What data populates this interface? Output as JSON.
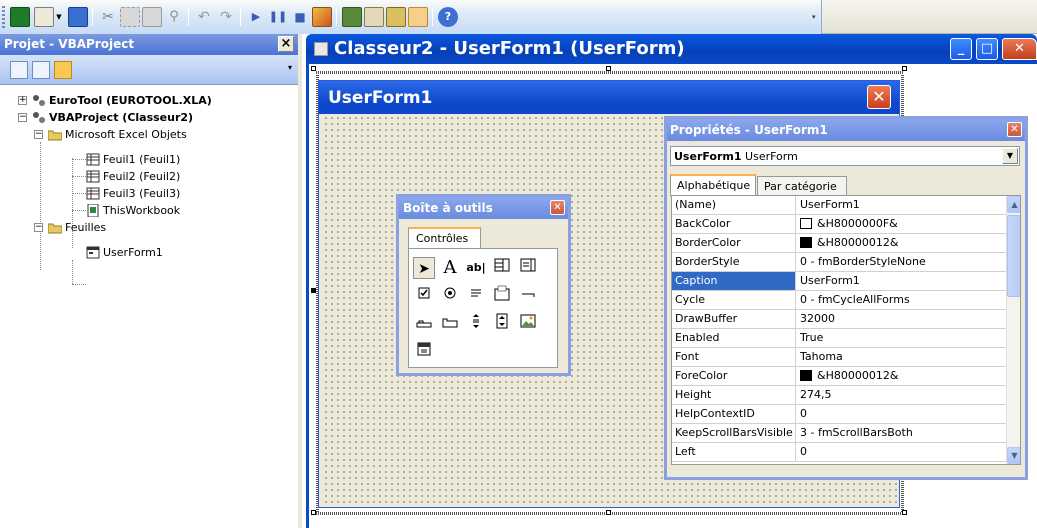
{
  "project_explorer": {
    "title": "Projet - VBAProject",
    "close": "×",
    "tree": {
      "eurotool": "EuroTool (EUROTOOL.XLA)",
      "vbaproject": "VBAProject (Classeur2)",
      "excel_objects": "Microsoft Excel Objets",
      "feuil1": "Feuil1 (Feuil1)",
      "feuil2": "Feuil2 (Feuil2)",
      "feuil3": "Feuil3 (Feuil3)",
      "thisworkbook": "ThisWorkbook",
      "feuilles": "Feuilles",
      "userform1": "UserForm1"
    }
  },
  "code_window": {
    "title": "Classeur2 - UserForm1 (UserForm)"
  },
  "userform": {
    "caption": "UserForm1",
    "close": "✕"
  },
  "toolbox": {
    "title": "Boîte à outils",
    "close": "✕",
    "tab": "Contrôles"
  },
  "properties": {
    "title": "Propriétés - UserForm1",
    "close": "✕",
    "object_name": "UserForm1",
    "object_type": "UserForm",
    "tabs": [
      "Alphabétique",
      "Par catégorie"
    ],
    "rows": [
      {
        "name": "(Name)",
        "value": "UserForm1"
      },
      {
        "name": "BackColor",
        "value": "&H8000000F&",
        "swatch": "#ffffff"
      },
      {
        "name": "BorderColor",
        "value": "&H80000012&",
        "swatch": "#000000"
      },
      {
        "name": "BorderStyle",
        "value": "0 - fmBorderStyleNone"
      },
      {
        "name": "Caption",
        "value": "UserForm1"
      },
      {
        "name": "Cycle",
        "value": "0 - fmCycleAllForms"
      },
      {
        "name": "DrawBuffer",
        "value": "32000"
      },
      {
        "name": "Enabled",
        "value": "True"
      },
      {
        "name": "Font",
        "value": "Tahoma"
      },
      {
        "name": "ForeColor",
        "value": "&H80000012&",
        "swatch": "#000000"
      },
      {
        "name": "Height",
        "value": "274,5"
      },
      {
        "name": "HelpContextID",
        "value": "0"
      },
      {
        "name": "KeepScrollBarsVisible",
        "value": "3 - fmScrollBarsBoth"
      },
      {
        "name": "Left",
        "value": "0"
      }
    ],
    "selected_row": "Caption"
  },
  "colors": {
    "xp_blue": "#0a4ac8",
    "selection": "#316ac5",
    "panel": "#ece9d8"
  }
}
